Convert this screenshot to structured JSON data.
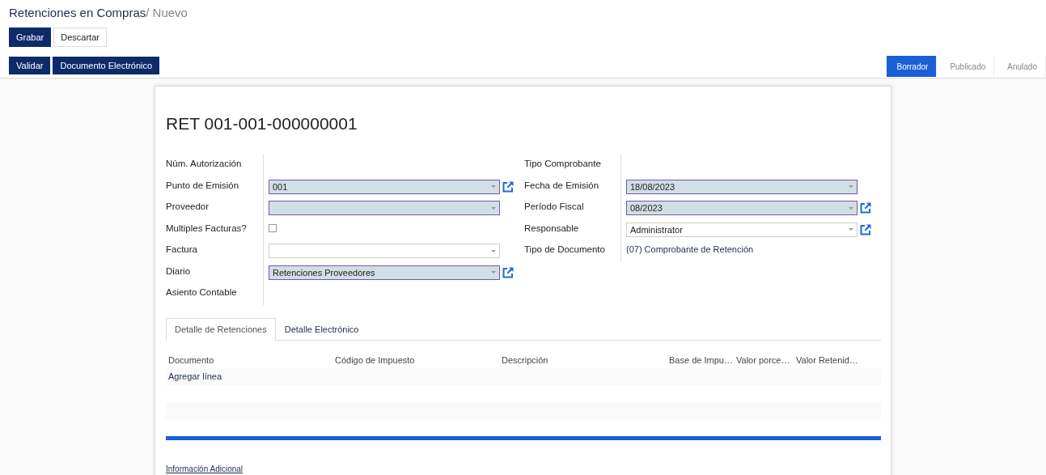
{
  "breadcrumb": {
    "parent": "Retenciones en Compras",
    "separator": "/",
    "current": "Nuevo"
  },
  "buttons": [
    {
      "label": "Grabar",
      "primary": true
    },
    {
      "label": "Descartar",
      "primary": false
    }
  ],
  "actions": [
    "Validar",
    "Documento Electrónico"
  ],
  "stages": [
    {
      "label": "Borrador",
      "selected": true
    },
    {
      "label": "Publicado",
      "selected": false
    },
    {
      "label": "Anulado",
      "selected": false
    }
  ],
  "title": "RET 001-001-000000001",
  "left_fields": [
    {
      "label": "Núm. Autorización",
      "kind": "empty"
    },
    {
      "label": "Punto de Emisión",
      "kind": "select",
      "required": true,
      "value": "001",
      "link": true
    },
    {
      "label": "Proveedor",
      "kind": "select",
      "required": true,
      "link": false
    },
    {
      "label": "Multiples Facturas?",
      "kind": "checkbox",
      "checked": false
    },
    {
      "label": "Factura",
      "kind": "select",
      "required": false,
      "link": false
    },
    {
      "label": "Diario",
      "kind": "select",
      "required": true,
      "value": "Retenciones Proveedores",
      "link": true
    },
    {
      "label": "Asiento Contable",
      "kind": "empty"
    }
  ],
  "right_fields": [
    {
      "label": "Tipo Comprobante",
      "kind": "empty"
    },
    {
      "label": "Fecha de Emisión",
      "kind": "select",
      "required": true,
      "value": "18/08/2023",
      "link": false
    },
    {
      "label": "Período Fiscal",
      "kind": "select",
      "required": true,
      "value": "08/2023",
      "link": true
    },
    {
      "label": "Responsable",
      "kind": "select",
      "required": false,
      "value": "Administrator",
      "link": true
    },
    {
      "label": "Tipo de Documento",
      "kind": "text",
      "value": "(07) Comprobante de Retención"
    }
  ],
  "tabs": [
    {
      "label": "Detalle de Retenciones",
      "selected": true
    },
    {
      "label": "Detalle Electrónico",
      "selected": false
    }
  ],
  "table": {
    "columns": [
      "Documento",
      "Código de Impuesto",
      "Descripción",
      "Base de Impu…",
      "Valor porce…",
      "Valor Retenid…"
    ],
    "add_line": "Agregar línea"
  },
  "footer_link": "Información Adicional"
}
